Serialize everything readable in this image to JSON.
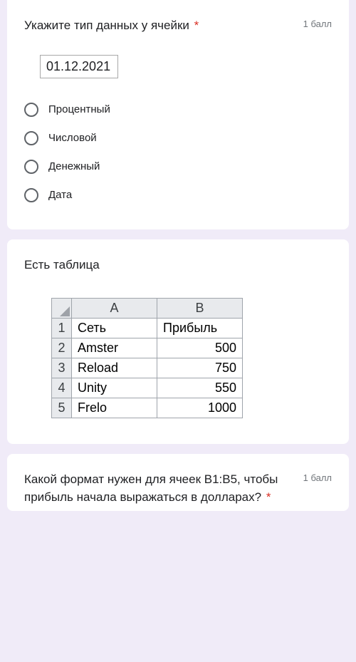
{
  "q1": {
    "title": "Укажите тип данных у ячейки",
    "required_mark": "*",
    "points": "1 балл",
    "cell_value": "01.12.2021",
    "options": [
      "Процентный",
      "Числовой",
      "Денежный",
      "Дата"
    ]
  },
  "info": {
    "title": "Есть таблица",
    "sheet": {
      "col_headers": [
        "A",
        "B"
      ],
      "rows": [
        {
          "n": "1",
          "a": "Сеть",
          "b": "Прибыль"
        },
        {
          "n": "2",
          "a": "Amster",
          "b": "500"
        },
        {
          "n": "3",
          "a": "Reload",
          "b": "750"
        },
        {
          "n": "4",
          "a": "Unity",
          "b": "550"
        },
        {
          "n": "5",
          "a": "Frelo",
          "b": "1000"
        }
      ]
    }
  },
  "q2": {
    "title": "Какой формат нужен для ячеек B1:B5, чтобы прибыль начала выражаться в долларах?",
    "required_mark": "*",
    "points": "1 балл"
  }
}
